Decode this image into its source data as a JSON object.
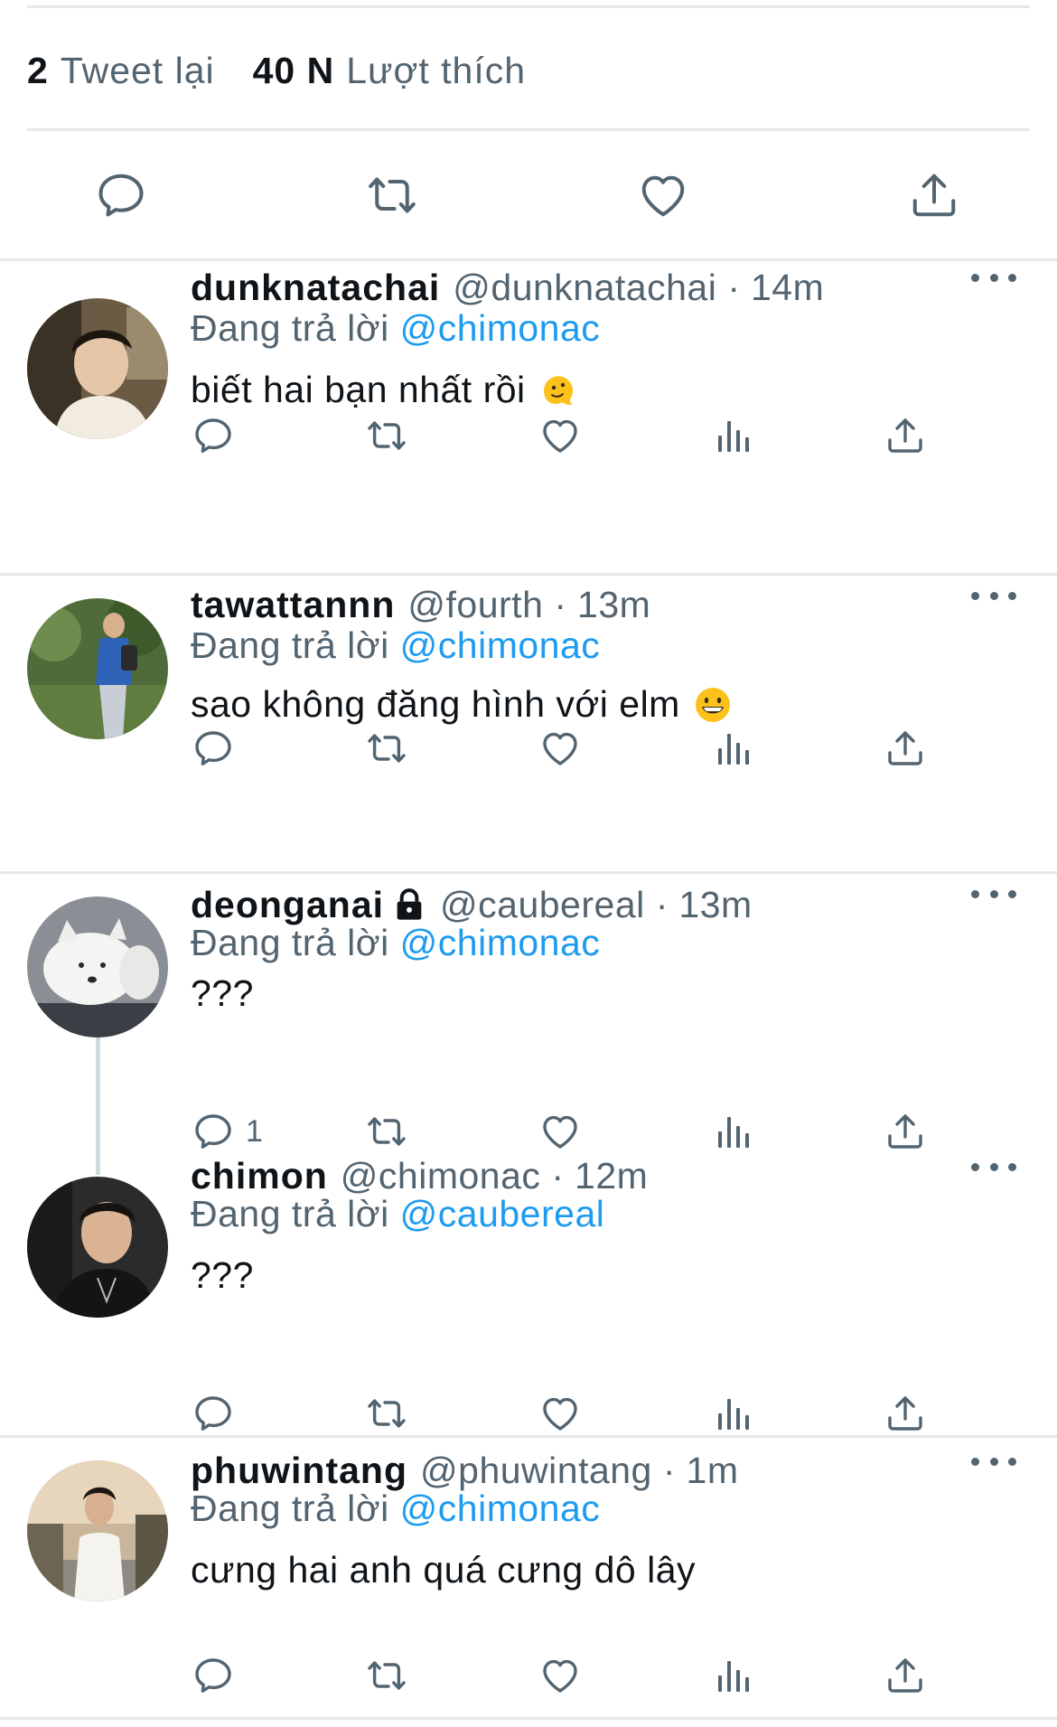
{
  "stats": {
    "retweets_count": "2",
    "retweets_label": "Tweet lại",
    "likes_count": "40 N",
    "likes_label": "Lượt thích"
  },
  "main_actions": [
    "reply-icon",
    "retweet-icon",
    "like-icon",
    "share-icon"
  ],
  "replying_label": "Đang trả lời",
  "tweets": [
    {
      "name": "dunknatachai",
      "handle": "@dunknatachai",
      "separator": "·",
      "time": "14m",
      "reply_to": "@chimonac",
      "text": "biết hai bạn nhất rồi",
      "emoji": "melting-face",
      "reply_count": "",
      "locked": false
    },
    {
      "name": "tawattannn",
      "handle": "@fourth",
      "separator": "·",
      "time": "13m",
      "reply_to": "@chimonac",
      "text": "sao không đăng hình với elm",
      "emoji": "grinning-face",
      "reply_count": "",
      "locked": false
    },
    {
      "name": "deonganai",
      "handle": "@caubereal",
      "separator": "·",
      "time": "13m",
      "reply_to": "@chimonac",
      "text": "???",
      "emoji": "",
      "reply_count": "1",
      "locked": true
    },
    {
      "name": "chimon",
      "handle": "@chimonac",
      "separator": "·",
      "time": "12m",
      "reply_to": "@caubereal",
      "text": "???",
      "emoji": "",
      "reply_count": "",
      "locked": false
    },
    {
      "name": "phuwintang",
      "handle": "@phuwintang",
      "separator": "·",
      "time": "1m",
      "reply_to": "@chimonac",
      "text": "cưng hai anh quá cưng dô lây",
      "emoji": "",
      "reply_count": "",
      "locked": false
    }
  ],
  "colors": {
    "link": "#1d9bf0",
    "secondary_text": "#536471",
    "primary_text": "#0f1419",
    "divider": "#e6e9ec"
  }
}
